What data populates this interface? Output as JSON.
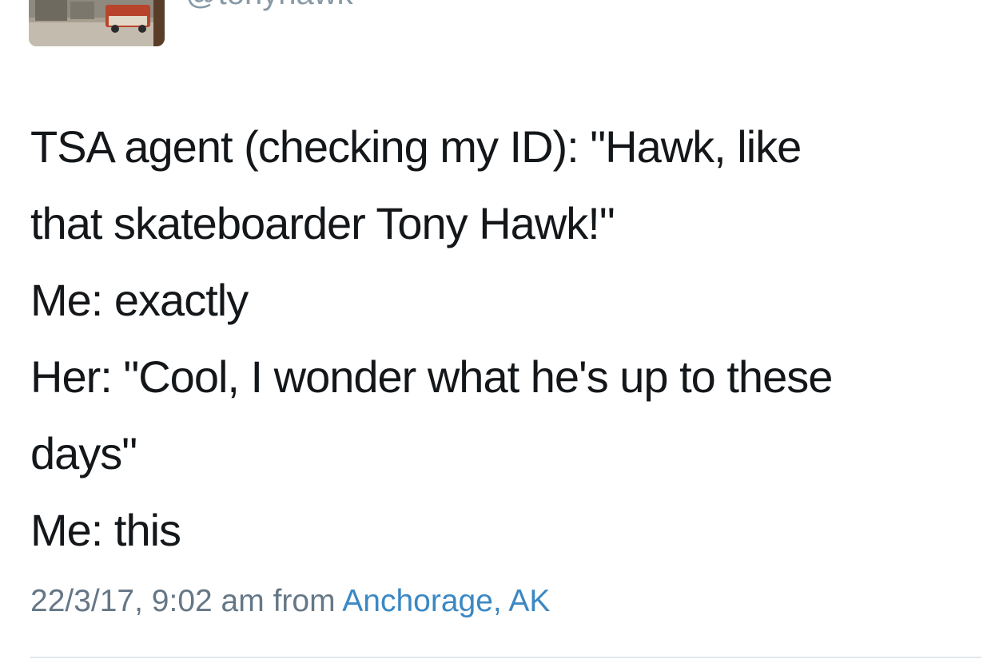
{
  "tweet": {
    "handle": "@tonyhawk",
    "text_lines": [
      "TSA agent (checking my ID): \"Hawk, like",
      "that skateboarder Tony Hawk!\"",
      "Me: exactly",
      "Her: \"Cool, I wonder what he's up to these",
      "days\"",
      "Me: this"
    ],
    "timestamp": "22/3/17, 9:02 am",
    "from_label": "from",
    "location": "Anchorage, AK"
  },
  "colors": {
    "text": "#14171a",
    "muted": "#657786",
    "link": "#3b88c3",
    "divider": "#e1e8ed"
  }
}
